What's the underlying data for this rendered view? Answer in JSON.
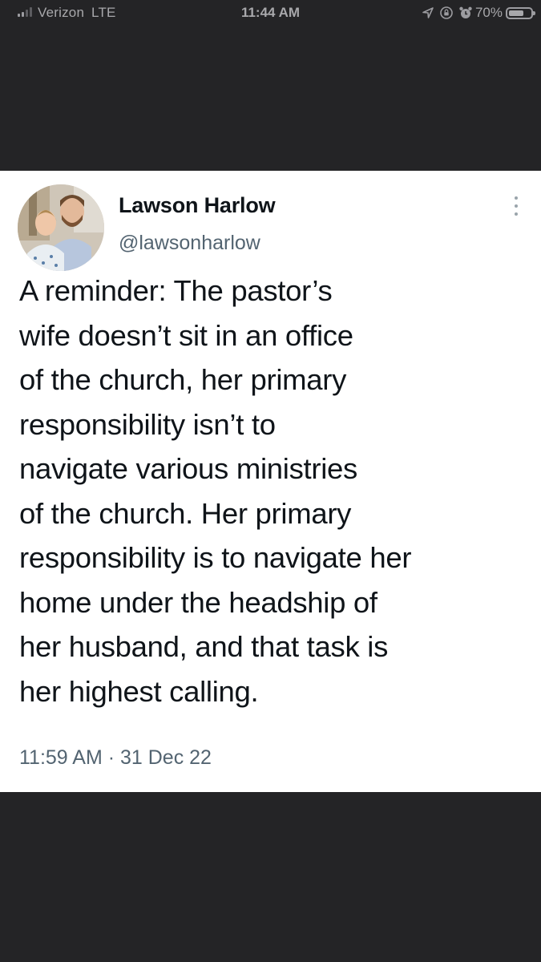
{
  "status_bar": {
    "carrier": "Verizon",
    "network": "LTE",
    "time": "11:44 AM",
    "battery_percent": "70%",
    "battery_level": 0.7,
    "icons": [
      "signal-icon",
      "location-icon",
      "screen-lock-icon",
      "alarm-icon",
      "battery-icon"
    ]
  },
  "tweet": {
    "display_name": "Lawson Harlow",
    "handle": "@lawsonharlow",
    "text_lines": [
      "A reminder: The pastor’s",
      "wife doesn’t sit in an office",
      "of the church, her primary",
      "responsibility isn’t to",
      "navigate various ministries",
      "of the church. Her primary",
      "responsibility is to navigate her",
      "home under the headship of",
      "her husband, and that task is",
      "her highest calling."
    ],
    "timestamp": "11:59 AM · 31 Dec 22",
    "avatar_icon": "profile-photo",
    "menu_icon": "more-vertical-icon"
  },
  "colors": {
    "background": "#242426",
    "card": "#ffffff",
    "primary_text": "#0f1419",
    "secondary_text": "#536471",
    "status_text": "#a8a8ab"
  }
}
